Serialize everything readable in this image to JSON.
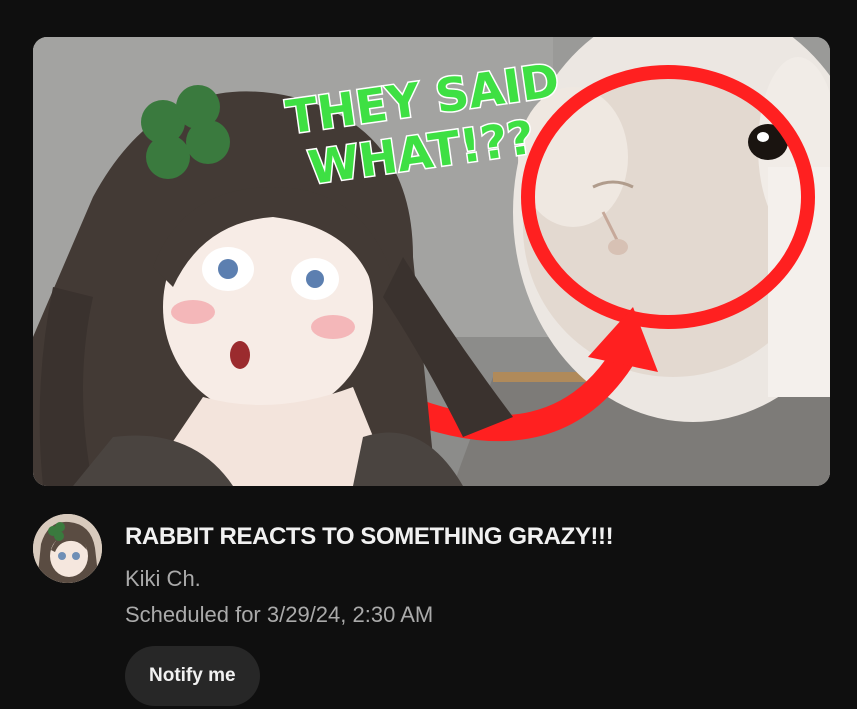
{
  "video": {
    "thumbnail_text_line1": "THEY SAID",
    "thumbnail_text_line2": "WHAT!??",
    "title": "RABBIT REACTS TO SOMETHING GRAZY!!!",
    "channel": "Kiki Ch.",
    "schedule": "Scheduled for 3/29/24, 2:30 AM",
    "notify_label": "Notify me"
  },
  "colors": {
    "background": "#0f0f0f",
    "title": "#f1f1f1",
    "secondary_text": "#aaaaaa",
    "button_bg": "#272727",
    "thumbnail_text": "#3ee043",
    "circle": "#ff2020"
  }
}
